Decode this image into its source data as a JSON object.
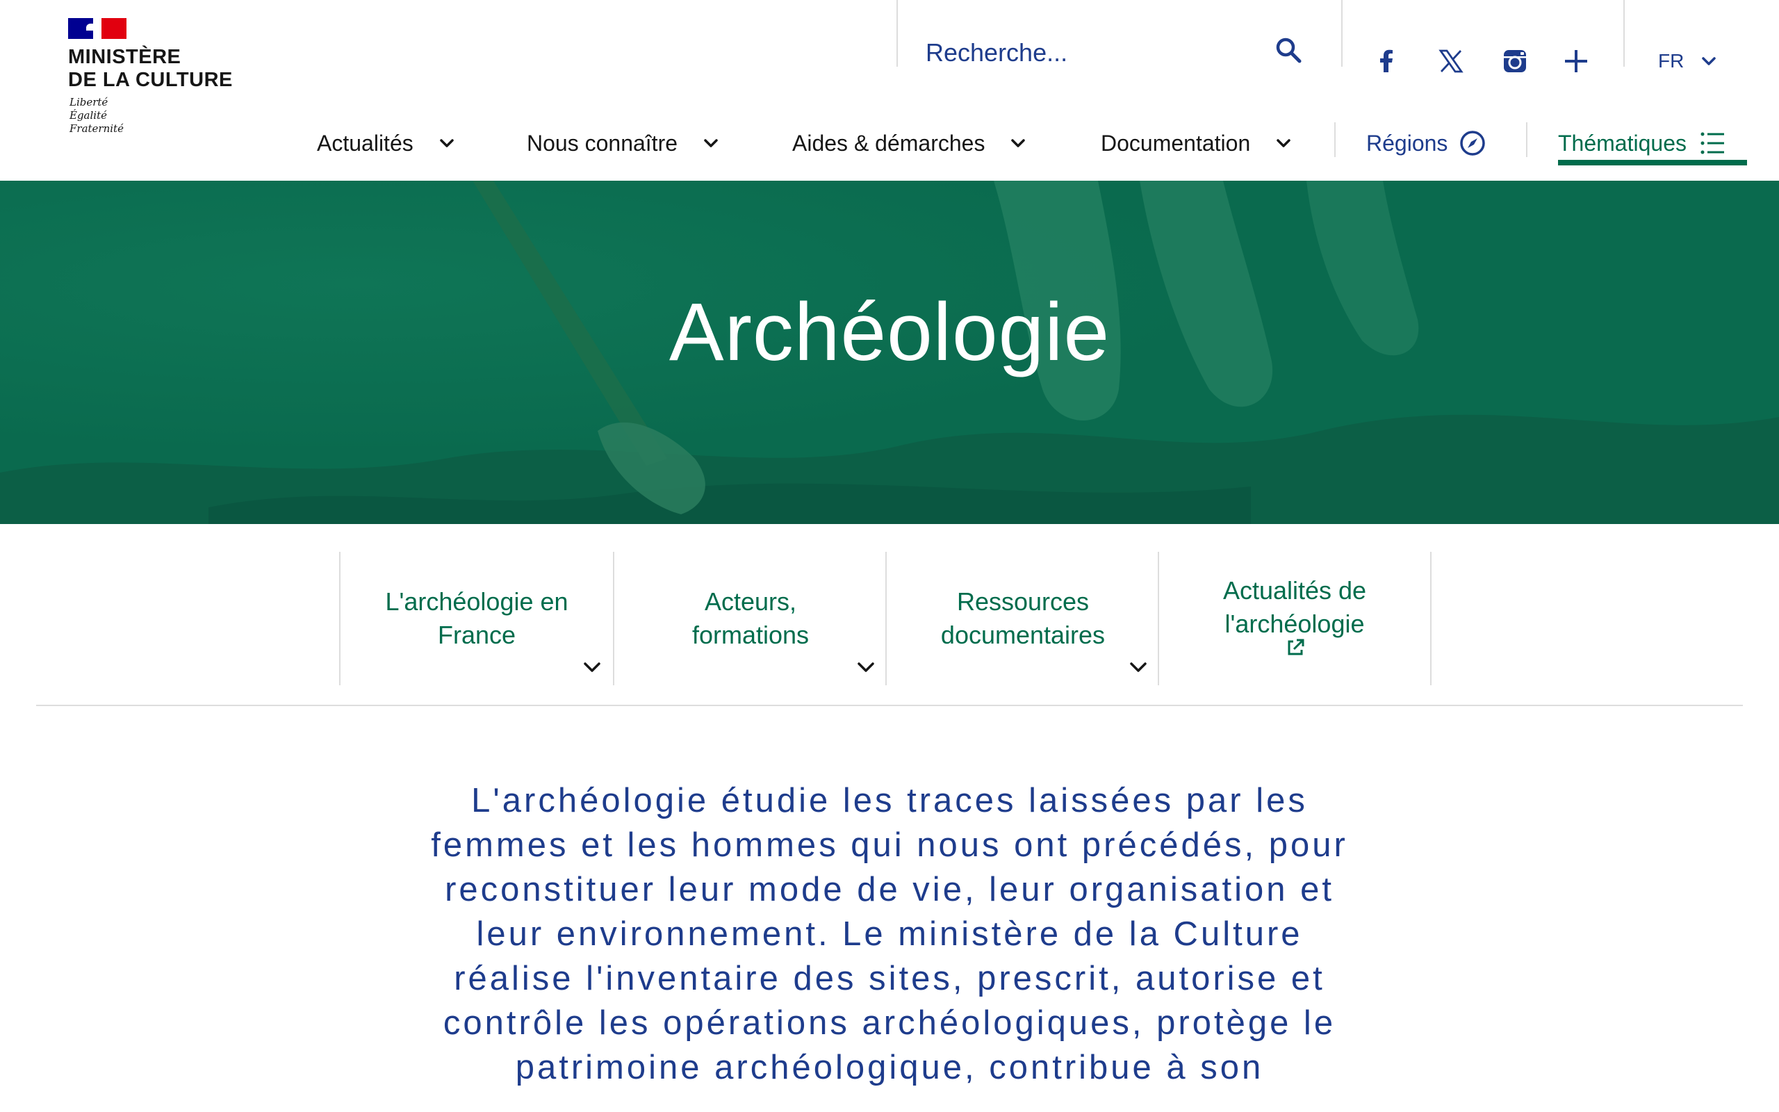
{
  "header": {
    "logo": {
      "lines": "MINISTÈRE\nDE LA CULTURE",
      "motto": "Liberté\nÉgalité\nFraternité"
    },
    "search": {
      "placeholder": "Recherche..."
    },
    "social": [
      "facebook-icon",
      "x-icon",
      "instagram-icon",
      "plus-icon"
    ],
    "language": {
      "selected": "FR"
    }
  },
  "nav": {
    "items": [
      {
        "label": "Actualités"
      },
      {
        "label": "Nous connaître"
      },
      {
        "label": "Aides & démarches"
      },
      {
        "label": "Documentation"
      },
      {
        "label": "Régions"
      },
      {
        "label": "Thématiques"
      }
    ]
  },
  "hero": {
    "title": "Archéologie"
  },
  "subnav": {
    "items": [
      {
        "label": "L'archéologie en\nFrance"
      },
      {
        "label": "Acteurs,\nformations"
      },
      {
        "label": "Ressources\ndocumentaires"
      },
      {
        "label": "Actualités de\nl'archéologie"
      }
    ]
  },
  "intro": {
    "text": "L'archéologie étudie les traces laissées par les femmes et les hommes qui nous ont précédés, pour reconstituer leur mode de vie, leur organisation et leur environnement. Le ministère de la Culture réalise l'inventaire des sites, prescrit, autorise et contrôle les opérations archéologiques, protège le patrimoine archéologique, contribue à son"
  },
  "colors": {
    "accent_green": "#006c4c",
    "hero_green": "#0a6a4e",
    "accent_blue": "#1e3c8c",
    "flag_blue": "#000091",
    "flag_red": "#e1000f"
  }
}
